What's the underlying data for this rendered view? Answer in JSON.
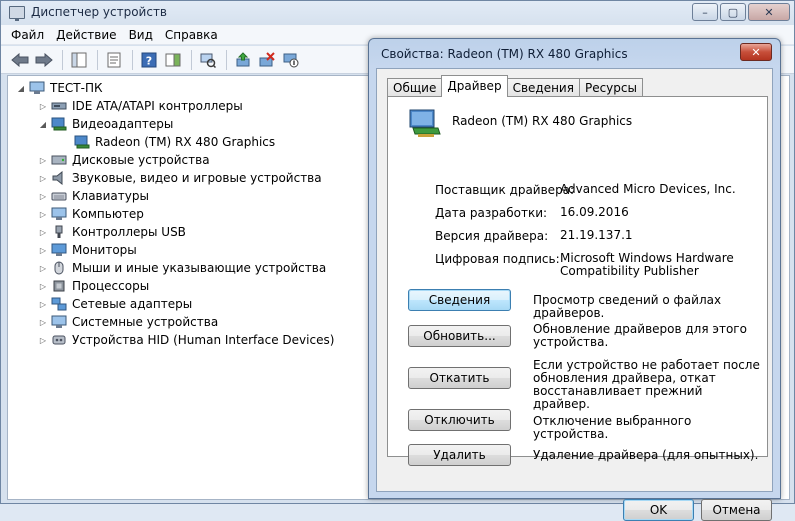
{
  "window": {
    "title": "Диспетчер устройств",
    "buttons": [
      "–",
      "▢",
      "✕"
    ]
  },
  "menu": [
    "Файл",
    "Действие",
    "Вид",
    "Справка"
  ],
  "tree": {
    "root": "ТЕСТ-ПК",
    "items": [
      {
        "label": "IDE ATA/ATAPI контроллеры",
        "icon": "ide-controller-icon"
      },
      {
        "label": "Видеоадаптеры",
        "icon": "display-adapter-icon",
        "expanded": true
      },
      {
        "label": "Radeon (TM) RX 480 Graphics",
        "icon": "display-adapter-icon",
        "child": true
      },
      {
        "label": "Дисковые устройства",
        "icon": "disk-icon"
      },
      {
        "label": "Звуковые, видео и игровые устройства",
        "icon": "speaker-icon"
      },
      {
        "label": "Клавиатуры",
        "icon": "keyboard-icon"
      },
      {
        "label": "Компьютер",
        "icon": "computer-icon"
      },
      {
        "label": "Контроллеры USB",
        "icon": "usb-icon"
      },
      {
        "label": "Мониторы",
        "icon": "monitor-icon"
      },
      {
        "label": "Мыши и иные указывающие устройства",
        "icon": "mouse-icon"
      },
      {
        "label": "Процессоры",
        "icon": "processor-icon"
      },
      {
        "label": "Сетевые адаптеры",
        "icon": "network-icon"
      },
      {
        "label": "Системные устройства",
        "icon": "system-icon"
      },
      {
        "label": "Устройства HID (Human Interface Devices)",
        "icon": "hid-icon"
      }
    ]
  },
  "dialog": {
    "title": "Свойства: Radeon (TM) RX 480 Graphics",
    "close": "✕",
    "tabs": [
      "Общие",
      "Драйвер",
      "Сведения",
      "Ресурсы"
    ],
    "active_tab": "Драйвер",
    "device_name": "Radeon (TM) RX 480 Graphics",
    "info": {
      "provider_label": "Поставщик драйвера:",
      "provider": "Advanced Micro Devices, Inc.",
      "date_label": "Дата разработки:",
      "date": "16.09.2016",
      "version_label": "Версия драйвера:",
      "version": "21.19.137.1",
      "signer_label": "Цифровая подпись:",
      "signer": "Microsoft Windows Hardware Compatibility Publisher"
    },
    "actions": [
      {
        "label": "Сведения",
        "desc": "Просмотр сведений о файлах драйверов."
      },
      {
        "label": "Обновить...",
        "desc": "Обновление драйверов для этого устройства."
      },
      {
        "label": "Откатить",
        "desc": "Если устройство не работает после обновления драйвера, откат восстанавливает прежний драйвер."
      },
      {
        "label": "Отключить",
        "desc": "Отключение выбранного устройства."
      },
      {
        "label": "Удалить",
        "desc": "Удаление драйвера (для опытных)."
      }
    ],
    "ok": "OK",
    "cancel": "Отмена"
  }
}
